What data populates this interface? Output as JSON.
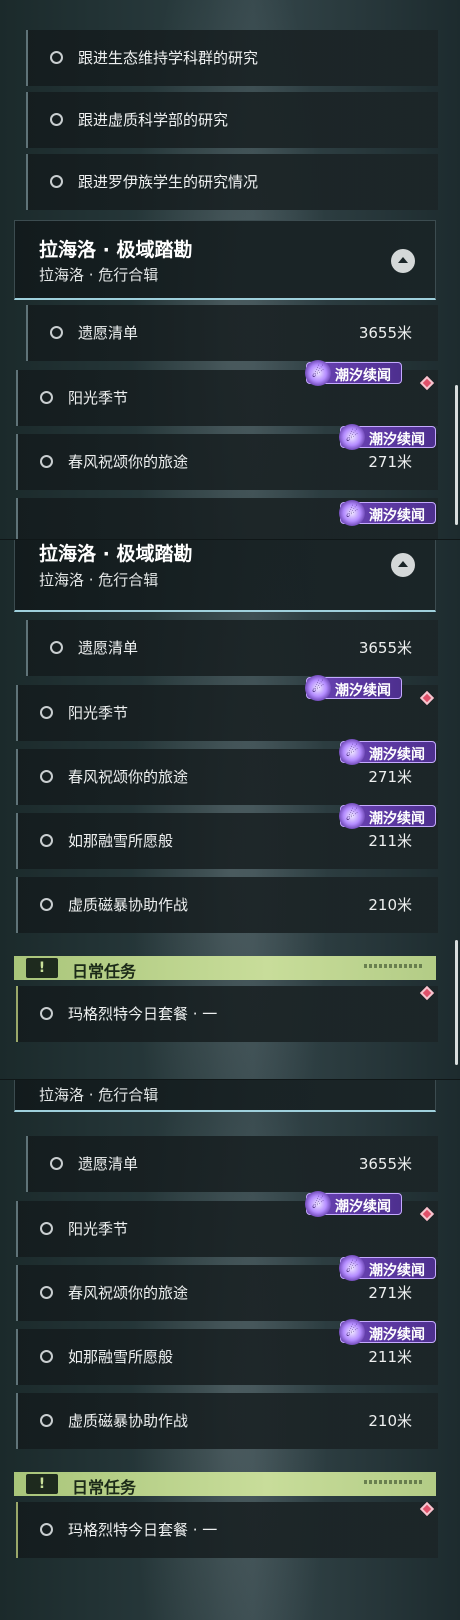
{
  "earlier_tasks": [
    {
      "label": "跟进生态维持学科群的研究"
    },
    {
      "label": "跟进虚质科学部的研究"
    },
    {
      "label": "跟进罗伊族学生的研究情况"
    }
  ],
  "quest_group": {
    "title": "拉海洛 · 极域踏勘",
    "subtitle": "拉海洛 · 危行合辑",
    "collapse_icon": "chevron-up-icon"
  },
  "tasks": [
    {
      "label": "遗愿清单",
      "distance": "3655米"
    },
    {
      "label": "阳光季节",
      "distance": "",
      "badge": "潮汐续闻",
      "marker": "red-diamond"
    },
    {
      "label": "春风祝颂你的旅途",
      "distance": "271米",
      "badge": "潮汐续闻"
    },
    {
      "label": "如那融雪所愿般",
      "distance": "211米",
      "badge": "潮汐续闻"
    },
    {
      "label": "虚质磁暴协助作战",
      "distance": "210米"
    }
  ],
  "daily": {
    "icon": "!",
    "label": "日常任务",
    "task": {
      "label": "玛格烈特今日套餐 · 一",
      "marker": "red-diamond"
    }
  },
  "badge_label": "潮汐续闻",
  "colors": {
    "badge_purple": "#6b43b6",
    "daily_green": "#b3cc86",
    "marker_red": "#e0506a",
    "header_underline": "#9fd0dc"
  }
}
